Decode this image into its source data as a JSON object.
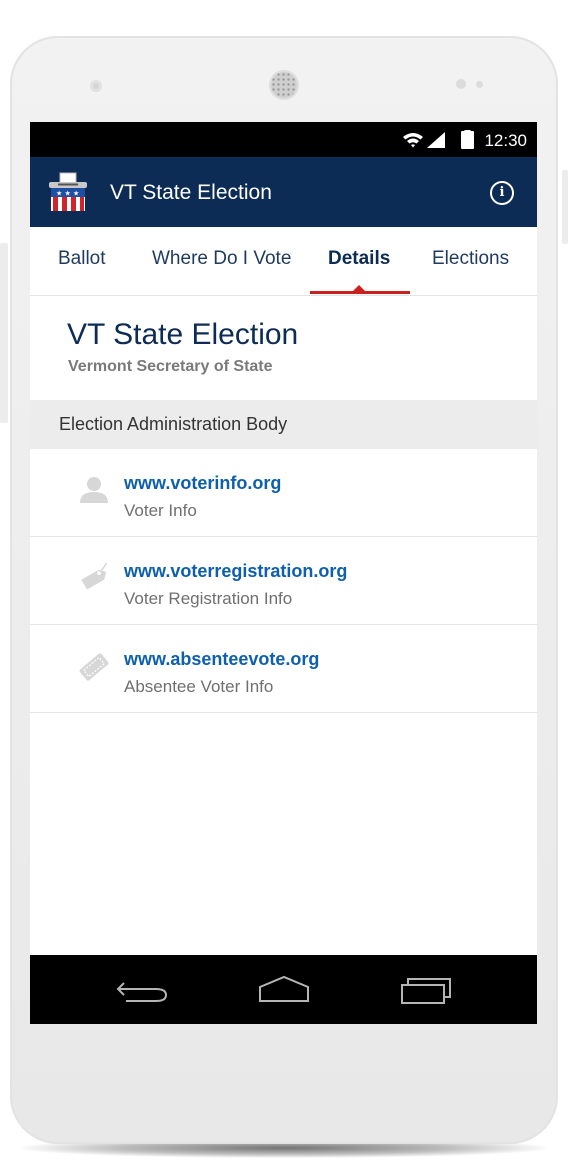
{
  "status": {
    "time": "12:30"
  },
  "app": {
    "title": "VT State Election"
  },
  "tabs": [
    {
      "label": "Ballot",
      "active": false
    },
    {
      "label": "Where Do I Vote",
      "active": false
    },
    {
      "label": "Details",
      "active": true
    },
    {
      "label": "Elections",
      "active": false
    }
  ],
  "election": {
    "title": "VT State Election",
    "org": "Vermont Secretary of State"
  },
  "section": {
    "header": "Election Administration Body"
  },
  "links": [
    {
      "url": "www.voterinfo.org",
      "description": "Voter Info",
      "icon": "person-icon"
    },
    {
      "url": "www.voterregistration.org",
      "description": "Voter Registration Info",
      "icon": "tag-icon"
    },
    {
      "url": "www.absenteevote.org",
      "description": "Absentee Voter Info",
      "icon": "ticket-icon"
    }
  ],
  "colors": {
    "appbar": "#0c2b55",
    "accent": "#cc1f1f",
    "link": "#0e5fae"
  }
}
